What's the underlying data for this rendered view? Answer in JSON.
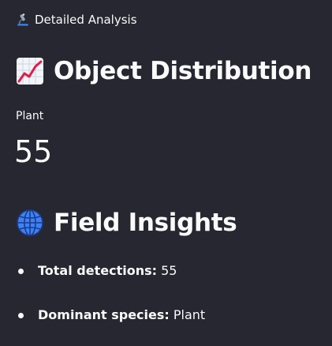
{
  "breadcrumb": {
    "icon": "microscope-icon",
    "label": "Detailed Analysis"
  },
  "sections": {
    "distribution": {
      "icon": "chart-increasing-icon",
      "title": "Object Distribution"
    },
    "insights": {
      "icon": "globe-icon",
      "title": "Field Insights"
    }
  },
  "metric": {
    "label": "Plant",
    "value": "55"
  },
  "insights": [
    {
      "label": "Total detections:",
      "value": "55"
    },
    {
      "label": "Dominant species:",
      "value": "Plant"
    }
  ],
  "colors": {
    "background": "#262730",
    "text": "#fafafa"
  }
}
